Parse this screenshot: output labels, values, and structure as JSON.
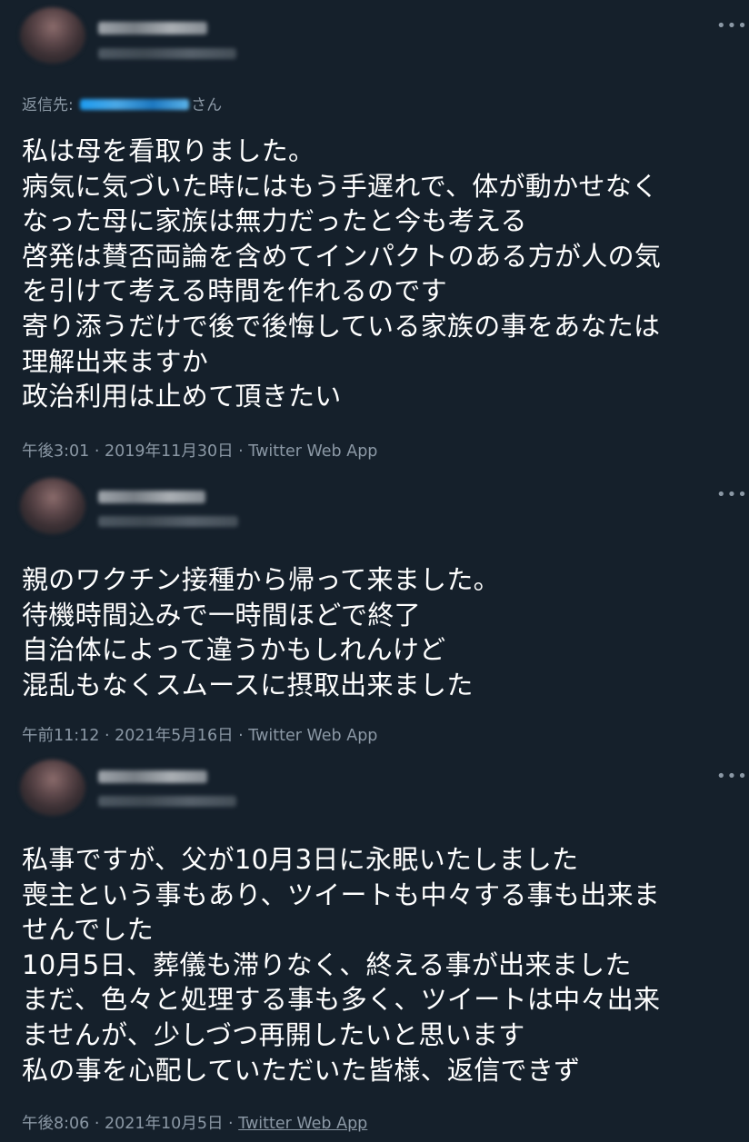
{
  "tweets": [
    {
      "reply_to": {
        "prefix": "返信先: ",
        "suffix": "さん"
      },
      "body": "私は母を看取りました。\n病気に気づいた時にはもう手遅れで、体が動かせなく\nなった母に家族は無力だったと今も考える\n啓発は賛否両論を含めてインパクトのある方が人の気\nを引けて考える時間を作れるのです\n寄り添うだけで後で後悔している家族の事をあなたは\n理解出来ますか\n政治利用は止めて頂きたい",
      "time": "午後3:01",
      "date": "2019年11月30日",
      "separator": " · ",
      "app": "Twitter Web App",
      "more": "•••"
    },
    {
      "body": "親のワクチン接種から帰って来ました。\n待機時間込みで一時間ほどで終了\n自治体によって違うかもしれんけど\n混乱もなくスムースに摂取出来ました",
      "time": "午前11:12",
      "date": "2021年5月16日",
      "separator": " · ",
      "app": "Twitter Web App",
      "more": "•••"
    },
    {
      "body": "私事ですが、父が10月3日に永眠いたしました\n喪主という事もあり、ツイートも中々する事も出来ま\nせんでした\n10月5日、葬儀も滞りなく、終える事が出来ました\nまだ、色々と処理する事も多く、ツイートは中々出来\nませんが、少しづつ再開したいと思います\n私の事を心配していただいた皆様、返信できず",
      "time": "午後8:06",
      "date": "2021年10月5日",
      "separator": " · ",
      "app": "Twitter Web App",
      "more": "•••"
    }
  ],
  "colors": {
    "background": "#15202b",
    "text": "#ffffff",
    "muted": "#8b98a5",
    "accent": "#1d9bf0"
  }
}
